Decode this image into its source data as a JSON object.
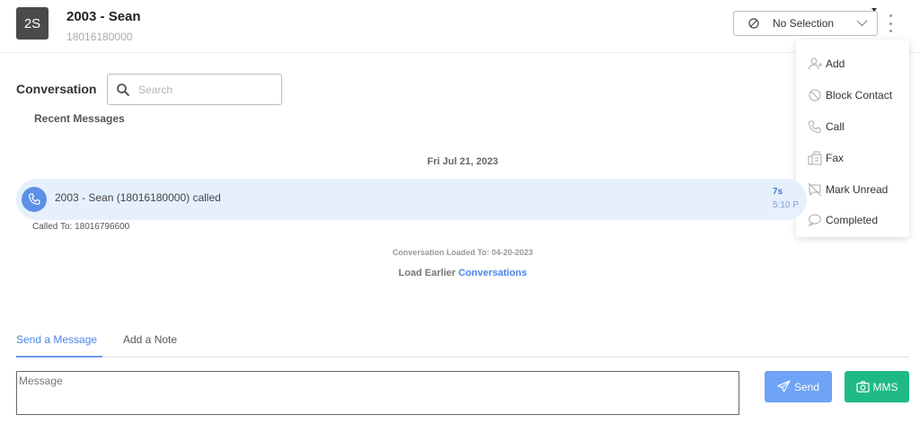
{
  "header": {
    "avatar_initials": "2S",
    "contact_name": "2003 - Sean",
    "contact_phone": "18016180000",
    "selection_label": "No Selection"
  },
  "menu": {
    "items": [
      {
        "label": "Add",
        "icon": "add-user-icon"
      },
      {
        "label": "Block Contact",
        "icon": "block-icon"
      },
      {
        "label": "Call",
        "icon": "phone-icon"
      },
      {
        "label": "Fax",
        "icon": "fax-icon"
      },
      {
        "label": "Mark Unread",
        "icon": "mark-unread-icon"
      },
      {
        "label": "Completed",
        "icon": "chat-bubble-icon"
      }
    ]
  },
  "conversation": {
    "label": "Conversation",
    "search_placeholder": "Search",
    "recent_label": "Recent Messages",
    "date": "Fri Jul 21, 2023",
    "call": {
      "text": "2003 - Sean (18016180000) called",
      "duration": "7s",
      "time": "5:10 P",
      "called_to": "Called To: 18016796600"
    },
    "loaded_to": "Conversation Loaded To: 04-20-2023",
    "load_earlier_prefix": "Load Earlier",
    "load_earlier_link": "Conversations"
  },
  "composer": {
    "tabs": [
      "Send a Message",
      "Add a Note"
    ],
    "active_tab": "Send a Message",
    "message_placeholder": "Message",
    "send_label": "Send",
    "mms_label": "MMS"
  },
  "colors": {
    "accent": "#4a86e8",
    "send_button": "#6fa3f5",
    "mms_button": "#1fba83",
    "call_row_bg": "#e6f0fd",
    "avatar_bg": "#4a4a4a"
  }
}
